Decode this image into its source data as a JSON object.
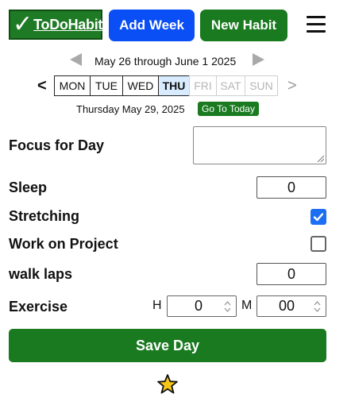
{
  "app": {
    "logo_text": "ToDoHabits",
    "logo_check": "✓"
  },
  "header": {
    "add_week_label": "Add Week",
    "new_habit_label": "New Habit"
  },
  "week_nav": {
    "range_text": "May 26 through June 1 2025",
    "prev_day": "<",
    "next_day": ">",
    "days": [
      {
        "label": "MON",
        "state": "past"
      },
      {
        "label": "TUE",
        "state": "past"
      },
      {
        "label": "WED",
        "state": "past"
      },
      {
        "label": "THU",
        "state": "current"
      },
      {
        "label": "FRI",
        "state": "future"
      },
      {
        "label": "SAT",
        "state": "future"
      },
      {
        "label": "SUN",
        "state": "future"
      }
    ],
    "current_date": "Thursday May 29, 2025",
    "go_today_label": "Go To Today"
  },
  "habits": {
    "focus": {
      "label": "Focus for Day",
      "value": ""
    },
    "sleep": {
      "label": "Sleep",
      "value": "0"
    },
    "stretching": {
      "label": "Stretching",
      "checked": true
    },
    "work_on_project": {
      "label": "Work on Project",
      "checked": false
    },
    "walk_laps": {
      "label": "walk laps",
      "value": "0"
    },
    "exercise": {
      "label": "Exercise",
      "hours_label": "H",
      "hours_value": "0",
      "minutes_label": "M",
      "minutes_value": "00"
    }
  },
  "footer": {
    "save_label": "Save Day",
    "star_icon": "star-icon"
  },
  "colors": {
    "primary_green": "#197a1f",
    "primary_blue": "#0a4ef5",
    "checkbox_blue": "#1c6ef2",
    "star_yellow": "#f5c518"
  }
}
